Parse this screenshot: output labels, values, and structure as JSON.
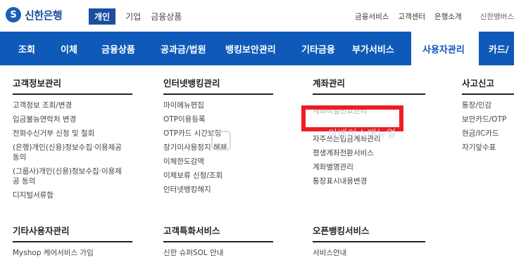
{
  "brand": {
    "logo_letter": "S",
    "name": "신한은행"
  },
  "topnav": [
    "개인",
    "기업",
    "금융상품"
  ],
  "util": [
    "금융서비스",
    "고객센터",
    "은행소개",
    "신한뱅버스"
  ],
  "mainnav": [
    "조회",
    "이체",
    "금융상품",
    "공과금/법원",
    "뱅킹보안관리",
    "기타금융",
    "부가서비스",
    "사용자관리",
    "카드/"
  ],
  "columns": [
    {
      "title": "고객정보관리",
      "items": [
        "고객정보 조회/변경",
        "입금불능연락처 변경",
        "전화수신거부 신청 및 철회",
        "(은행)개인(신용)정보수집·이용제공",
        "동의",
        "(그룹사)개인(신용)정보수집·이용제",
        "공 동의",
        "디지털서류함"
      ]
    },
    {
      "title": "인터넷뱅킹관리",
      "items": [
        "마이메뉴편집",
        "OTP이용등록",
        "OTP카드 시간보정",
        "장기미사용정지 해제",
        "이체한도감액",
        "이체보류 신청/조회",
        "인터넷뱅킹해지"
      ]
    },
    {
      "title": "계좌관리",
      "items": [
        "계좌비밀번호관리",
        "자주쓰는입금계좌관리",
        "평생계좌전환서비스",
        "계좌별명관리",
        "통장표시내용변경"
      ]
    },
    {
      "title": "사고신고",
      "items": [
        "통장/인감",
        "보안카드/OTP",
        "현금/IC카드",
        "자기앞수표"
      ]
    }
  ],
  "columns2": [
    {
      "title": "기타사용자관리",
      "items": [
        "Myshop 케어서비스 가입"
      ]
    },
    {
      "title": "고객특화서비스",
      "items": [
        "신한 슈퍼SOL 안내"
      ]
    },
    {
      "title": "오픈뱅킹서비스",
      "items": [
        "서비스안내"
      ]
    }
  ],
  "watermark": "이베이스매뉴얼",
  "colors": {
    "brand_blue": "#0f5ab8",
    "highlight": "#ee1c25"
  }
}
